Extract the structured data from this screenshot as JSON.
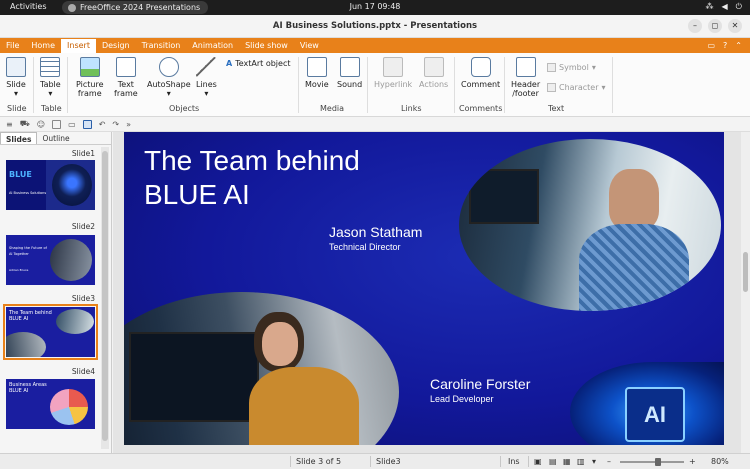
{
  "system": {
    "activities": "Activities",
    "app_name": "FreeOffice 2024 Presentations",
    "clock": "Jun 17  09:48"
  },
  "window": {
    "title": "AI Business Solutions.pptx - Presentations",
    "buttons": [
      "–",
      "◻",
      "✕"
    ]
  },
  "menu": {
    "tabs": [
      "File",
      "Home",
      "Insert",
      "Design",
      "Transition",
      "Animation",
      "Slide show",
      "View"
    ],
    "active": "Insert"
  },
  "ribbon": {
    "slide": {
      "label": "Slide",
      "group": "Slide"
    },
    "table": {
      "label": "Table",
      "group": "Table"
    },
    "picture_frame": {
      "label": "Picture\nframe"
    },
    "text_frame": {
      "label": "Text\nframe"
    },
    "autoshape": {
      "label": "AutoShape"
    },
    "lines": {
      "label": "Lines"
    },
    "textart": {
      "label": "TextArt object"
    },
    "objects_group": "Objects",
    "movie": {
      "label": "Movie"
    },
    "sound": {
      "label": "Sound"
    },
    "media_group": "Media",
    "hyperlink": {
      "label": "Hyperlink"
    },
    "actions": {
      "label": "Actions"
    },
    "links_group": "Links",
    "comment": {
      "label": "Comment"
    },
    "comments_group": "Comments",
    "header_footer": {
      "label": "Header\n/footer"
    },
    "symbol": {
      "label": "Symbol"
    },
    "character": {
      "label": "Character"
    },
    "text_group": "Text"
  },
  "side_panel": {
    "tabs": [
      "Slides",
      "Outline"
    ],
    "active_tab": "Slides",
    "slides": [
      {
        "label": "Slide1",
        "text": "BLUE",
        "sub": "AI Business Solutions"
      },
      {
        "label": "Slide2",
        "text": "Shaping the Future of AI Together",
        "sub": "Adrian Bruce"
      },
      {
        "label": "Slide3",
        "text": "The Team behind BLUE AI",
        "sub": ""
      },
      {
        "label": "Slide4",
        "text": "Business Areas BLUE AI",
        "sub": ""
      }
    ],
    "selected": 2
  },
  "slide": {
    "title_line1": "The Team behind",
    "title_line2": "BLUE AI",
    "person1_name": "Jason Statham",
    "person1_role": "Technical Director",
    "person2_name": "Caroline Forster",
    "person2_role": "Lead Developer",
    "badge": "AI"
  },
  "status": {
    "slide_of": "Slide 3 of 5",
    "slide_name": "Slide3",
    "mode": "Ins",
    "zoom": "80%",
    "zoom_level": 0.6
  },
  "colors": {
    "accent": "#e8811a",
    "slide_bg": "#12189a"
  }
}
